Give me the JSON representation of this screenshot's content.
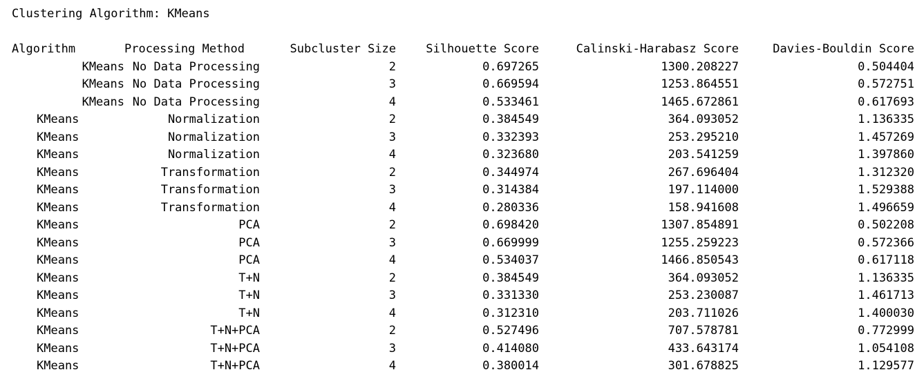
{
  "output": {
    "heading": "Clustering Algorithm: KMeans",
    "columns": [
      "Algorithm",
      "Processing Method",
      "Subcluster Size",
      "Silhouette Score",
      "Calinski-Harabasz Score",
      "Davies-Bouldin Score"
    ],
    "rows": [
      [
        "KMeans",
        "No Data Processing",
        "2",
        "0.697265",
        "1300.208227",
        "0.504404"
      ],
      [
        "KMeans",
        "No Data Processing",
        "3",
        "0.669594",
        "1253.864551",
        "0.572751"
      ],
      [
        "KMeans",
        "No Data Processing",
        "4",
        "0.533461",
        "1465.672861",
        "0.617693"
      ],
      [
        "KMeans",
        "Normalization",
        "2",
        "0.384549",
        "364.093052",
        "1.136335"
      ],
      [
        "KMeans",
        "Normalization",
        "3",
        "0.332393",
        "253.295210",
        "1.457269"
      ],
      [
        "KMeans",
        "Normalization",
        "4",
        "0.323680",
        "203.541259",
        "1.397860"
      ],
      [
        "KMeans",
        "Transformation",
        "2",
        "0.344974",
        "267.696404",
        "1.312320"
      ],
      [
        "KMeans",
        "Transformation",
        "3",
        "0.314384",
        "197.114000",
        "1.529388"
      ],
      [
        "KMeans",
        "Transformation",
        "4",
        "0.280336",
        "158.941608",
        "1.496659"
      ],
      [
        "KMeans",
        "PCA",
        "2",
        "0.698420",
        "1307.854891",
        "0.502208"
      ],
      [
        "KMeans",
        "PCA",
        "3",
        "0.669999",
        "1255.259223",
        "0.572366"
      ],
      [
        "KMeans",
        "PCA",
        "4",
        "0.534037",
        "1466.850543",
        "0.617118"
      ],
      [
        "KMeans",
        "T+N",
        "2",
        "0.384549",
        "364.093052",
        "1.136335"
      ],
      [
        "KMeans",
        "T+N",
        "3",
        "0.331330",
        "253.230087",
        "1.461713"
      ],
      [
        "KMeans",
        "T+N",
        "4",
        "0.312310",
        "203.711026",
        "1.400030"
      ],
      [
        "KMeans",
        "T+N+PCA",
        "2",
        "0.527496",
        "707.578781",
        "0.772999"
      ],
      [
        "KMeans",
        "T+N+PCA",
        "3",
        "0.414080",
        "433.643174",
        "1.054108"
      ],
      [
        "KMeans",
        "T+N+PCA",
        "4",
        "0.380014",
        "301.678825",
        "1.129577"
      ]
    ]
  }
}
